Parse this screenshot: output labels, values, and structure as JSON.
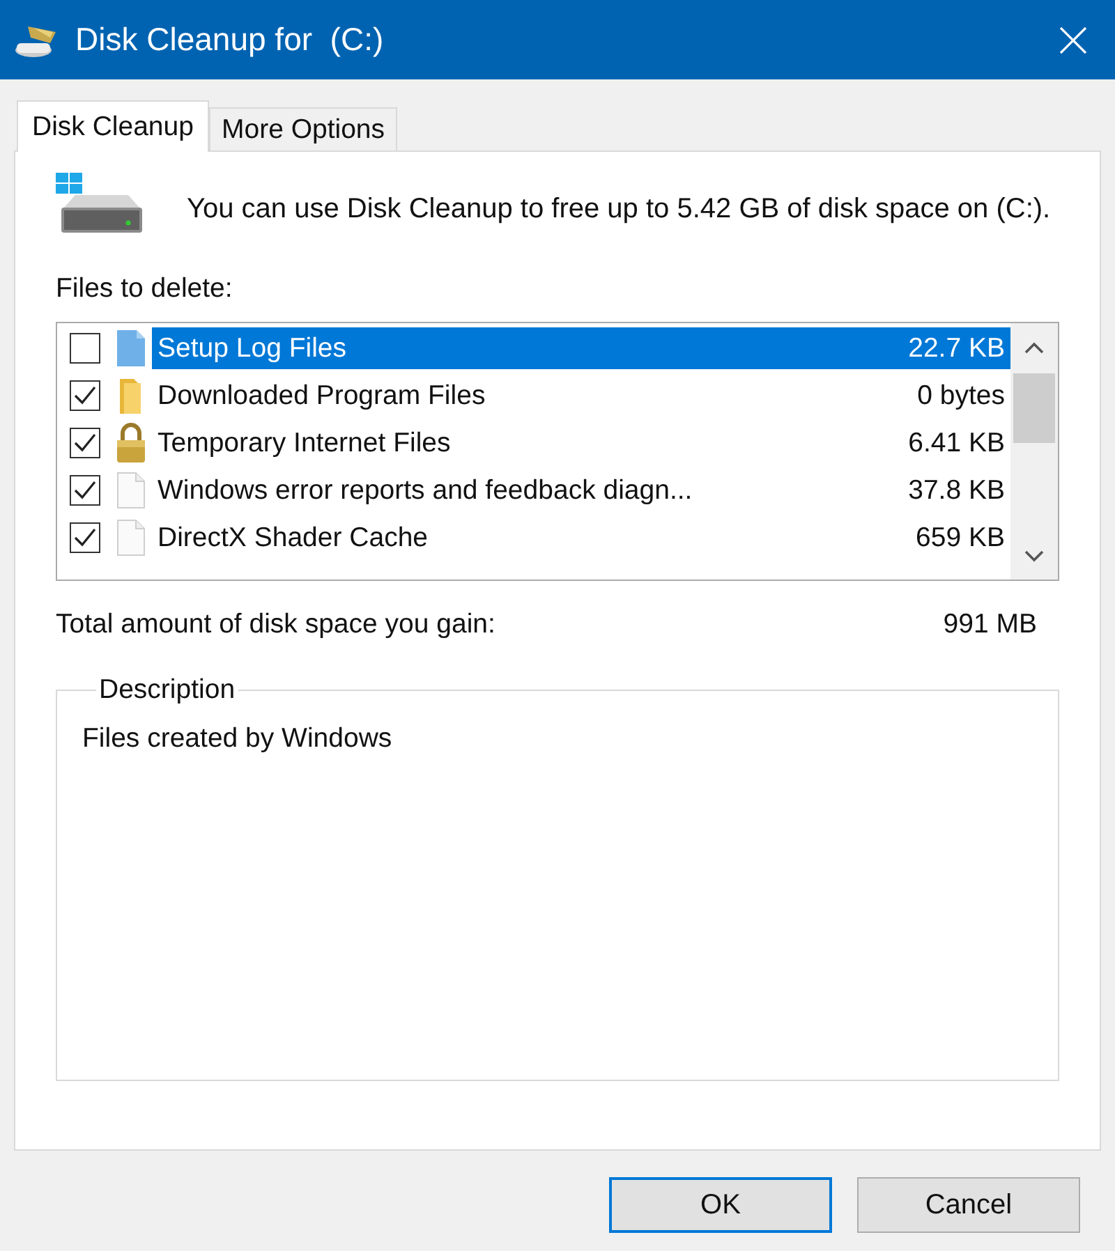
{
  "window": {
    "title": "Disk Cleanup for  (C:)"
  },
  "tabs": [
    {
      "label": "Disk Cleanup",
      "selected": true
    },
    {
      "label": "More Options",
      "selected": false
    }
  ],
  "intro": "You can use Disk Cleanup to free up to 5.42 GB of disk space on (C:).",
  "files_label": "Files to delete:",
  "files": [
    {
      "name": "Setup Log Files",
      "size": "22.7 KB",
      "checked": false,
      "selected": true,
      "kind": "log"
    },
    {
      "name": "Downloaded Program Files",
      "size": "0 bytes",
      "checked": true,
      "selected": false,
      "kind": "folder"
    },
    {
      "name": "Temporary Internet Files",
      "size": "6.41 KB",
      "checked": true,
      "selected": false,
      "kind": "lock"
    },
    {
      "name": "Windows error reports and feedback diagn...",
      "size": "37.8 KB",
      "checked": true,
      "selected": false,
      "kind": "page"
    },
    {
      "name": "DirectX Shader Cache",
      "size": "659 KB",
      "checked": true,
      "selected": false,
      "kind": "page"
    }
  ],
  "total": {
    "label": "Total amount of disk space you gain:",
    "value": "991 MB"
  },
  "description": {
    "legend": "Description",
    "text": "Files created by Windows"
  },
  "buttons": [
    {
      "label": "OK",
      "default": true
    },
    {
      "label": "Cancel",
      "default": false
    }
  ]
}
